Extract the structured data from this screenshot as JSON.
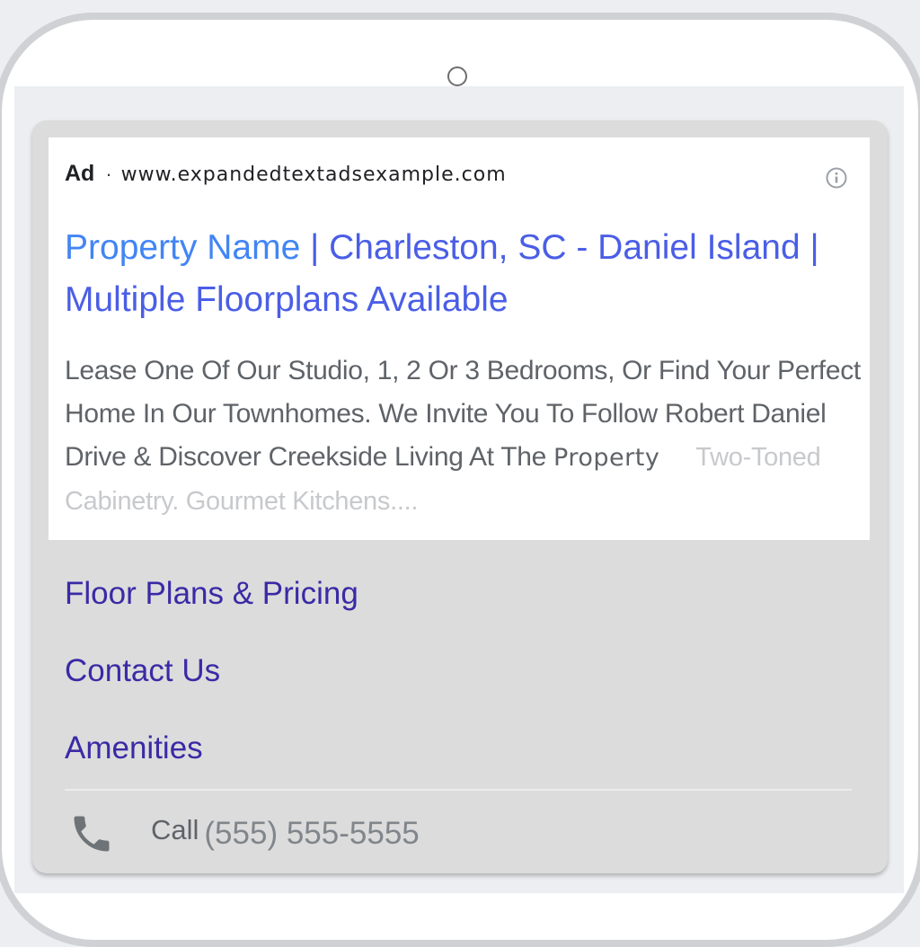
{
  "ad": {
    "label": "Ad",
    "separator": "·",
    "display_url": "www.expandedtextadsexample.com",
    "headline_part1": "Property Name",
    "headline_part2": " | Charleston, SC - Daniel Island | Multiple Floorplans Available",
    "description_main": "Lease One Of Our Studio, 1, 2 Or 3 Bedrooms, Or Find Your Perfect Home In Our Townhomes. We Invite You To Follow Robert Daniel Drive & Discover Creekside Living At The ",
    "description_tail": "Property",
    "description_faded": "Two-Toned Cabinetry. Gourmet Kitchens...."
  },
  "sitelinks": [
    {
      "label": "Floor Plans & Pricing"
    },
    {
      "label": "Contact Us"
    },
    {
      "label": "Amenities"
    }
  ],
  "call": {
    "label": "Call",
    "number": "(555) 555-5555"
  },
  "icons": {
    "info": "info-icon",
    "phone": "phone-icon",
    "camera": "front-camera"
  },
  "colors": {
    "headline_primary": "#4285f4",
    "headline_secondary": "#4a5ee6",
    "sitelink": "#3a2aa6",
    "card_background": "#dcdcdc"
  }
}
